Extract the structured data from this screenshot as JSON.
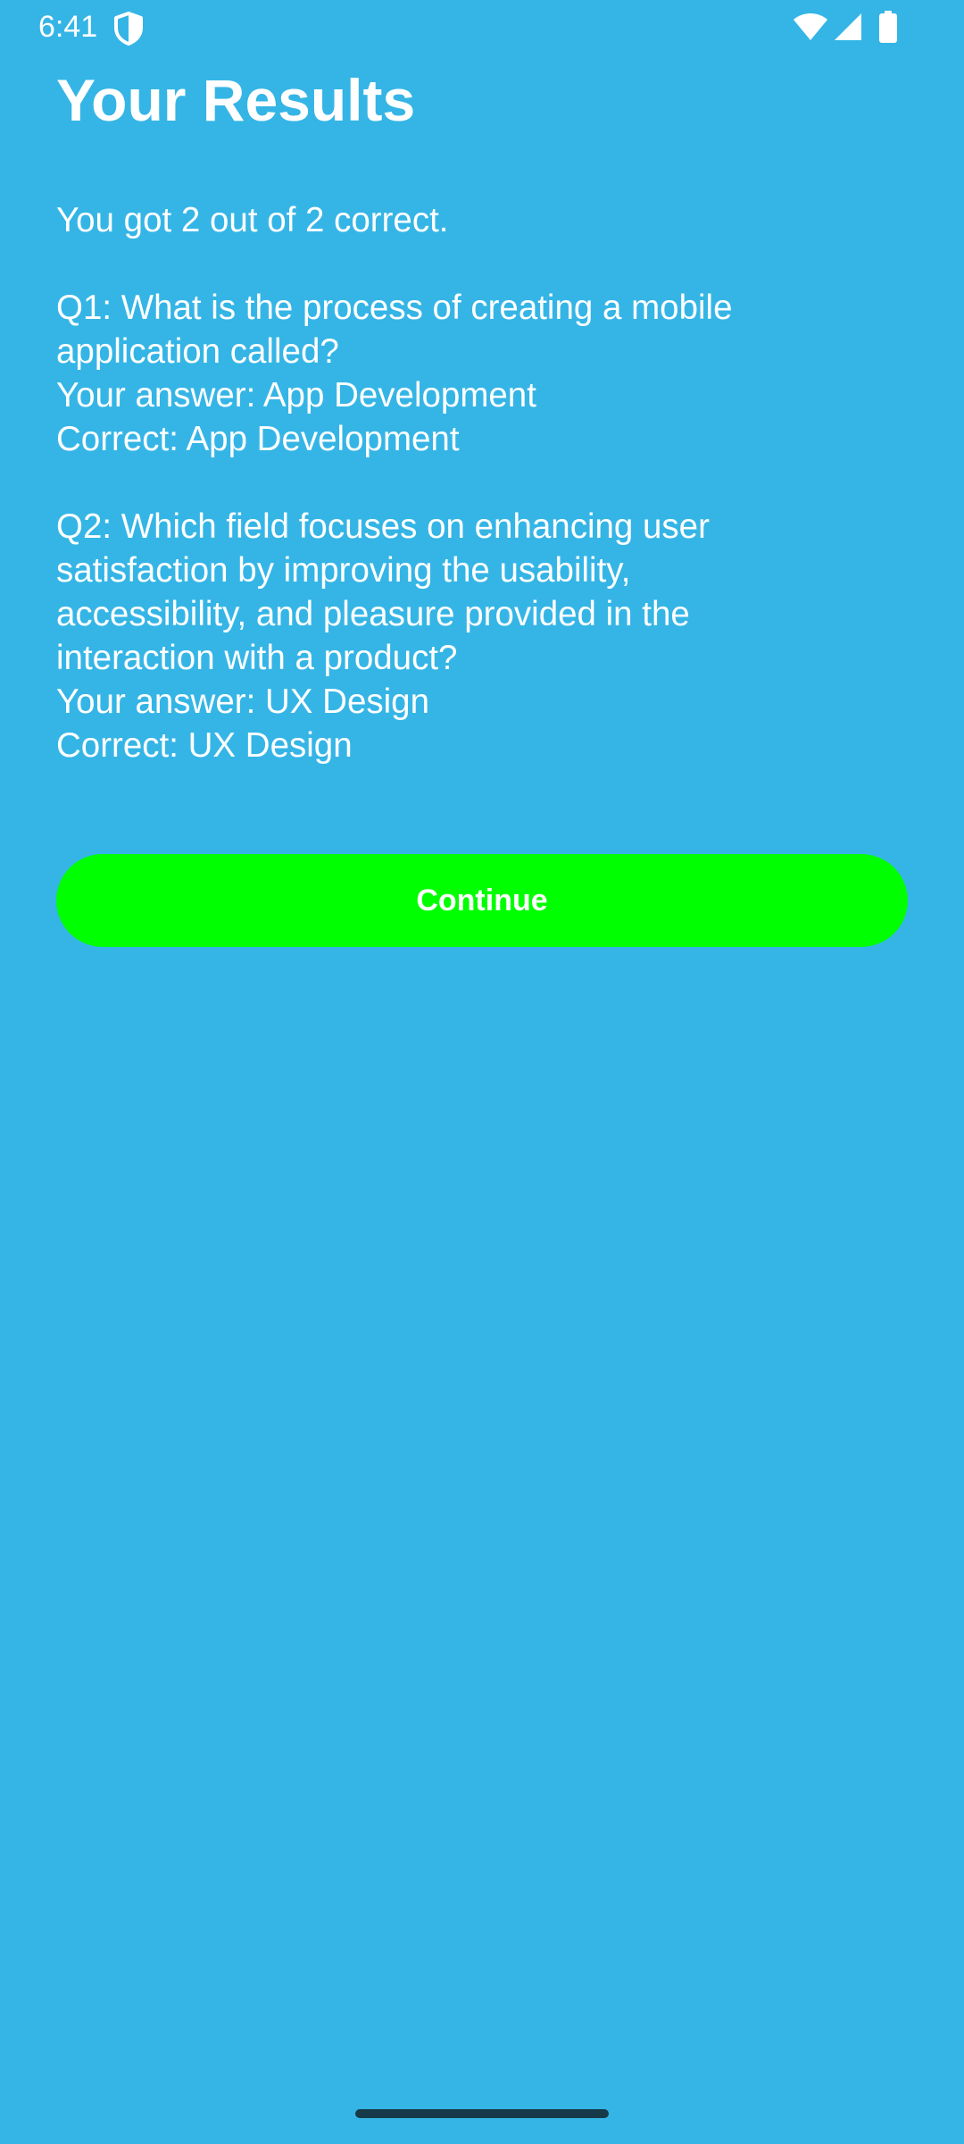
{
  "status_bar": {
    "time": "6:41",
    "icons": [
      "shield-icon",
      "wifi-icon",
      "signal-icon",
      "battery-icon"
    ]
  },
  "colors": {
    "background": "#35B5E6",
    "button": "#00FF00",
    "text": "#FFFFFF"
  },
  "screen": {
    "title": "Your Results",
    "score": "You got 2 out of 2 correct.",
    "questions": [
      {
        "question_lines": [
          "Q1: What is the process of creating a mobile",
          "application called?"
        ],
        "your_answer": "Your answer: App Development",
        "correct": "Correct: App Development"
      },
      {
        "question_lines": [
          "Q2: Which field focuses on enhancing user",
          "satisfaction by improving the usability,",
          "accessibility, and pleasure provided in the",
          "interaction with a product?"
        ],
        "your_answer": "Your answer: UX Design",
        "correct": "Correct: UX Design"
      }
    ],
    "continue_label": "Continue"
  }
}
